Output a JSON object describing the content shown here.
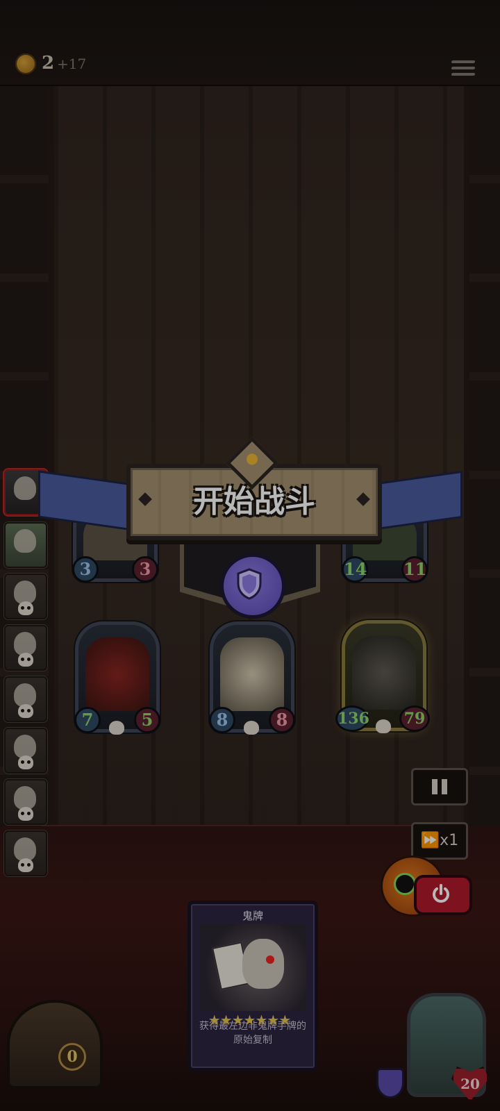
{
  "topbar": {
    "coins": "2",
    "coins_gain": "+17",
    "menu_icon": "hamburger-menu-icon"
  },
  "banner": {
    "title": "开始战斗",
    "emblem_icon": "shield-icon"
  },
  "board": {
    "top_row": [
      {
        "attack": "3",
        "health": "3"
      },
      {
        "attack": "14",
        "health": "11"
      }
    ],
    "bottom_row": [
      {
        "attack": "7",
        "health": "5"
      },
      {
        "attack": "8",
        "health": "8"
      },
      {
        "attack": "136",
        "health": "79"
      }
    ]
  },
  "controls": {
    "pause_icon": "pause-icon",
    "speed_label": "⏩x1",
    "power_icon": "power-icon"
  },
  "hand_card": {
    "name": "鬼牌",
    "stars": "★★★★★★★",
    "description": "获得最左边非鬼牌手牌的原始复制"
  },
  "chest": {
    "count": "0"
  },
  "hero": {
    "health": "20"
  },
  "colors": {
    "accent_gold": "#e8b635",
    "shield_purple": "#7a68d0",
    "power_red": "#b01a2c"
  }
}
